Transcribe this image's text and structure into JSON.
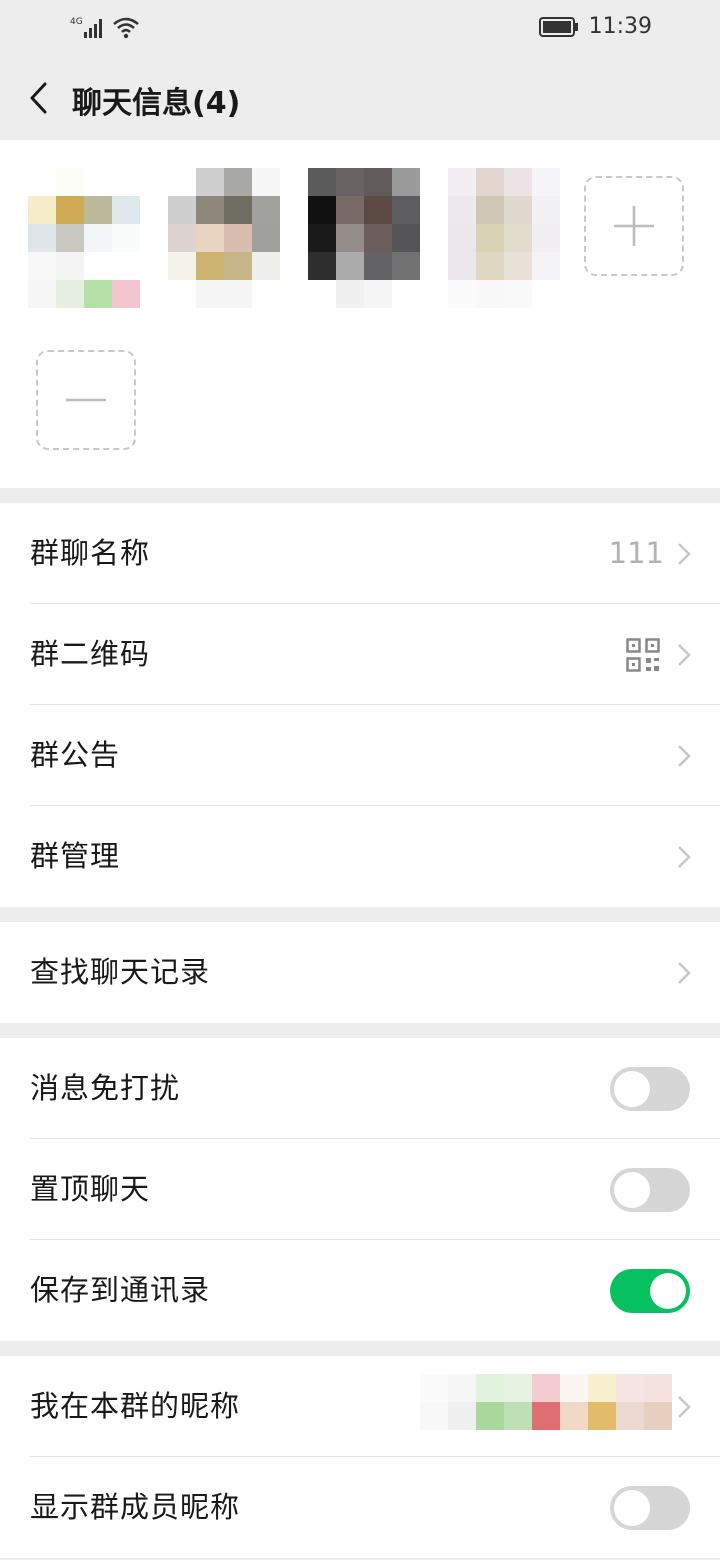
{
  "status": {
    "network": "4G",
    "time": "11:39"
  },
  "header": {
    "title": "聊天信息(4)"
  },
  "members": {
    "count": 4,
    "add_icon": "plus-icon",
    "remove_icon": "minus-icon"
  },
  "settings": {
    "group_name_label": "群聊名称",
    "group_name_value": "111",
    "qr_label": "群二维码",
    "notice_label": "群公告",
    "manage_label": "群管理",
    "search_label": "查找聊天记录",
    "mute_label": "消息免打扰",
    "mute_on": false,
    "pin_label": "置顶聊天",
    "pin_on": false,
    "save_label": "保存到通讯录",
    "save_on": true,
    "nickname_label": "我在本群的昵称",
    "show_nick_label": "显示群成员昵称",
    "show_nick_on": false
  },
  "colors": {
    "accent": "#07c160",
    "toggle_off": "#d6d6d6"
  }
}
